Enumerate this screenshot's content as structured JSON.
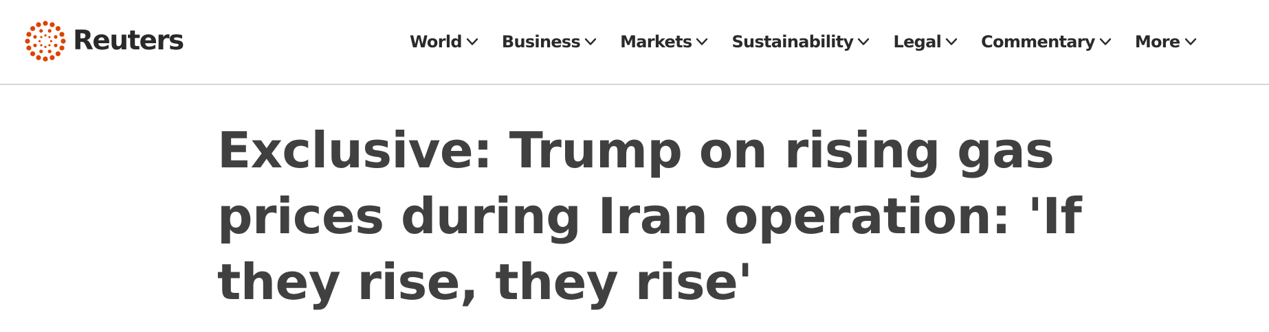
{
  "brand": {
    "name": "Reuters",
    "logo_color": "#dc4300",
    "text_color": "#2a2a2a"
  },
  "nav": {
    "items": [
      {
        "label": "World",
        "icon": "chevron-down-icon"
      },
      {
        "label": "Business",
        "icon": "chevron-down-icon"
      },
      {
        "label": "Markets",
        "icon": "chevron-down-icon"
      },
      {
        "label": "Sustainability",
        "icon": "chevron-down-icon"
      },
      {
        "label": "Legal",
        "icon": "chevron-down-icon"
      },
      {
        "label": "Commentary",
        "icon": "chevron-down-icon"
      },
      {
        "label": "More",
        "icon": "chevron-down-icon"
      }
    ]
  },
  "article": {
    "headline": "Exclusive: Trump on rising gas prices during Iran operation: 'If they rise, they rise'",
    "headline_color": "#404040"
  }
}
